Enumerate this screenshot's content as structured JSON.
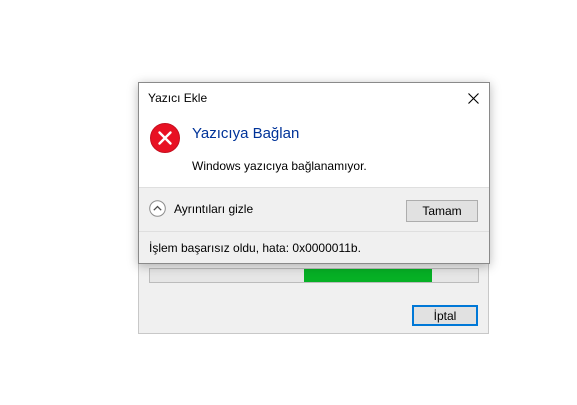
{
  "progress_window": {
    "progress_fraction_start": 0.47,
    "progress_fraction_end": 0.86,
    "progress_color": "#06b025",
    "cancel_label": "İptal"
  },
  "dialog": {
    "title": "Yazıcı Ekle",
    "close_icon": "close-icon",
    "error_icon": "error-x-icon",
    "main_instruction": "Yazıcıya Bağlan",
    "content": "Windows yazıcıya bağlanamıyor.",
    "details_toggle_label": "Ayrıntıları gizle",
    "ok_label": "Tamam",
    "details_text": "İşlem başarısız oldu, hata: 0x0000011b.",
    "colors": {
      "instruction": "#003399",
      "error_icon": "#e81123",
      "button_focus": "#0078d7"
    }
  }
}
